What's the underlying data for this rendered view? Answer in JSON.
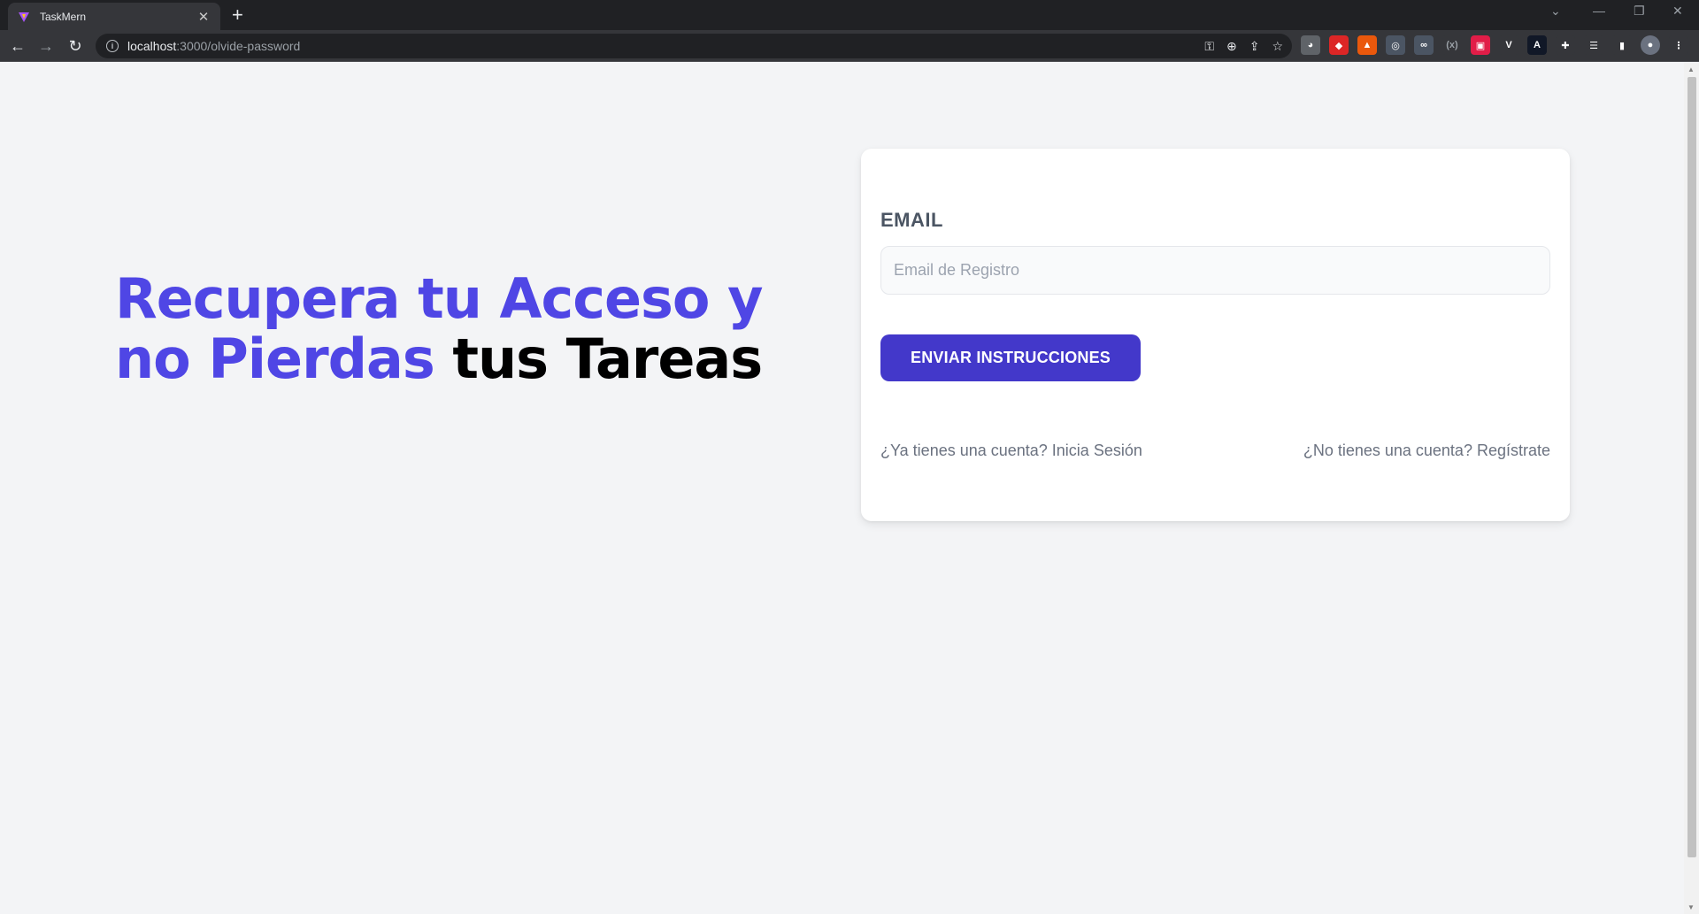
{
  "browser": {
    "tab_title": "TaskMern",
    "url_host": "localhost",
    "url_path": ":3000/olvide-password",
    "colors": {
      "chrome_dark": "#202124",
      "chrome_mid": "#35363a"
    },
    "icons": [
      "back-icon",
      "forward-icon",
      "reload-icon",
      "info-icon",
      "key-icon",
      "zoom-icon",
      "share-icon",
      "star-icon",
      "extensions-icon",
      "reading-list-icon",
      "sidebar-icon",
      "profile-icon",
      "menu-icon"
    ]
  },
  "hero": {
    "line1_accent": "Recupera tu Acceso y no",
    "line2_accent": "Pierdas",
    "line2_dark": "tus Tareas",
    "accent_color": "#4f46e5"
  },
  "form": {
    "email_label": "EMAIL",
    "email_placeholder": "Email de Registro",
    "email_value": "",
    "submit_label": "ENVIAR INSTRUCCIONES",
    "button_color": "#4338ca"
  },
  "links": {
    "login": "¿Ya tienes una cuenta? Inicia Sesión",
    "register": "¿No tienes una cuenta? Regístrate"
  }
}
